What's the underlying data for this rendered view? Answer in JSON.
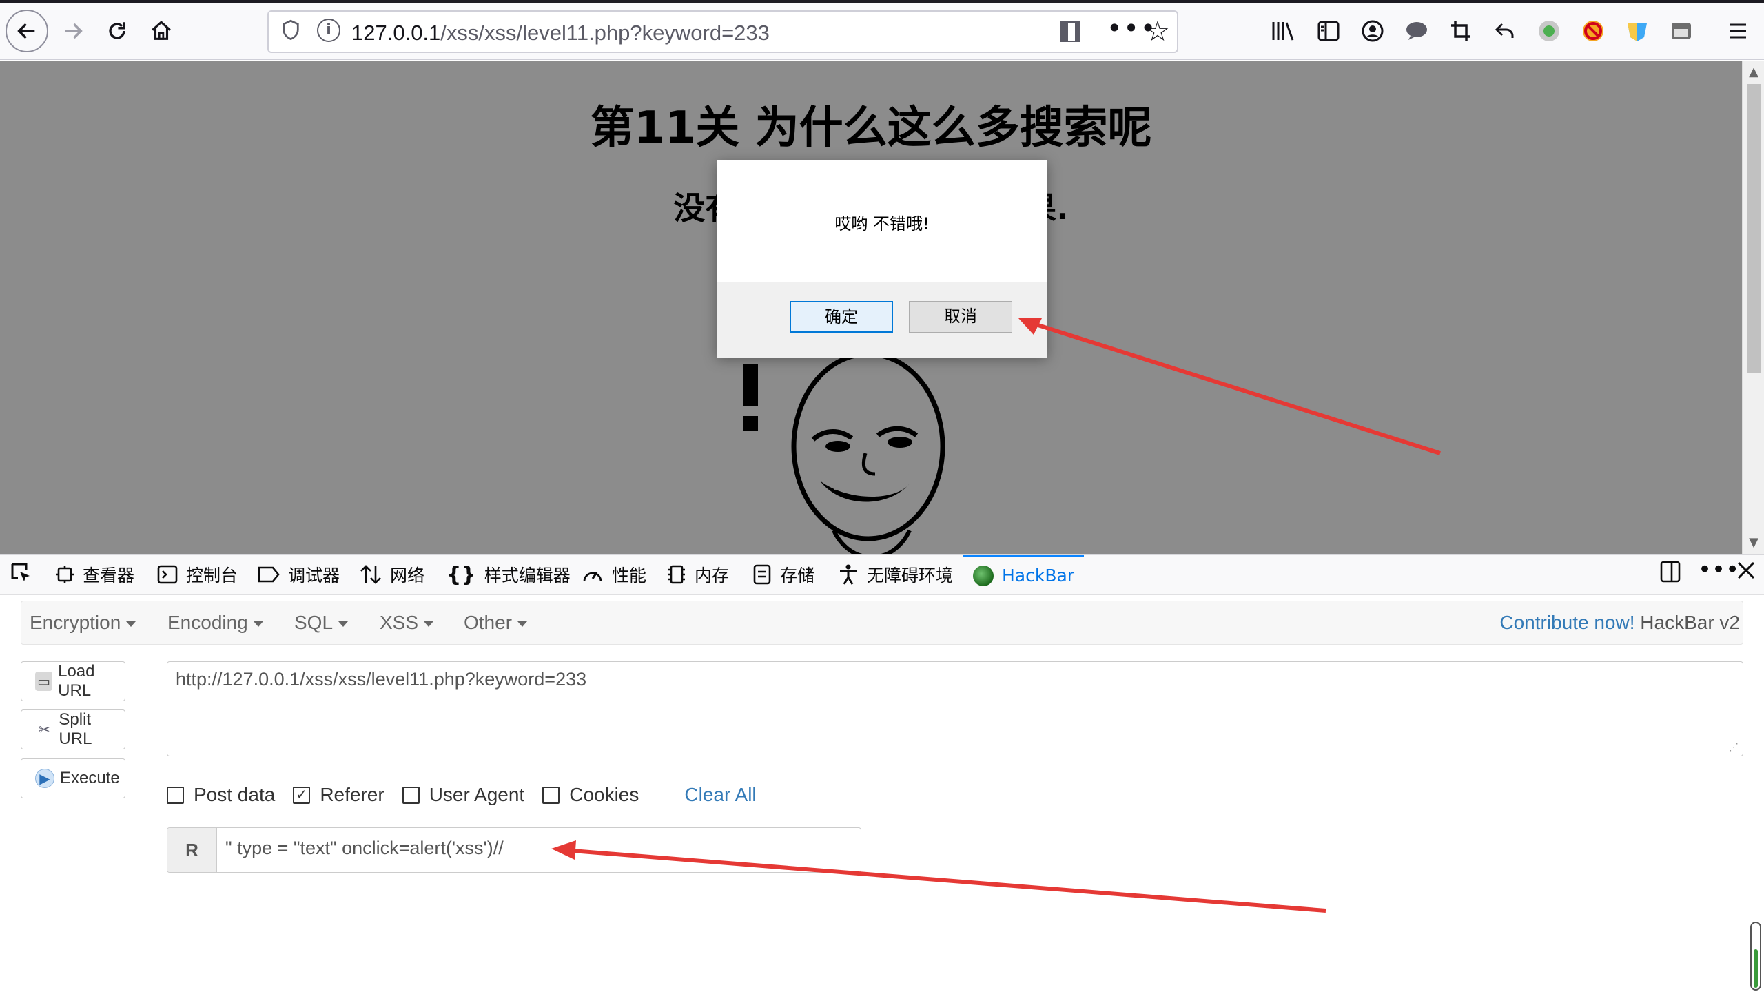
{
  "browser": {
    "url_host": "127.0.0.1",
    "url_path": "/xss/xss/level11.php?keyword=233"
  },
  "page": {
    "title": "第11关 为什么这么多搜索呢",
    "subtitle": "没有找到和233相关的结果."
  },
  "dialog": {
    "message": "哎哟 不错哦!",
    "ok_label": "确定",
    "cancel_label": "取消"
  },
  "devtools": {
    "tabs": [
      {
        "label": "查看器",
        "icon": "inspector-icon"
      },
      {
        "label": "控制台",
        "icon": "console-icon"
      },
      {
        "label": "调试器",
        "icon": "debugger-icon"
      },
      {
        "label": "网络",
        "icon": "network-icon"
      },
      {
        "label": "样式编辑器",
        "icon": "style-editor-icon"
      },
      {
        "label": "性能",
        "icon": "performance-icon"
      },
      {
        "label": "内存",
        "icon": "memory-icon"
      },
      {
        "label": "存储",
        "icon": "storage-icon"
      },
      {
        "label": "无障碍环境",
        "icon": "accessibility-icon"
      },
      {
        "label": "HackBar",
        "icon": "hackbar-icon"
      }
    ],
    "active_tab": "HackBar"
  },
  "hackbar": {
    "menu": [
      "Encryption",
      "Encoding",
      "SQL",
      "XSS",
      "Other"
    ],
    "contribute": "Contribute now!",
    "version": "HackBar v2",
    "buttons": {
      "load_url": "Load URL",
      "split_url": "Split URL",
      "execute": "Execute"
    },
    "url_value": "http://127.0.0.1/xss/xss/level11.php?keyword=233",
    "checks": {
      "post_data": {
        "label": "Post data",
        "checked": false
      },
      "referer": {
        "label": "Referer",
        "checked": true
      },
      "user_agent": {
        "label": "User Agent",
        "checked": false
      },
      "cookies": {
        "label": "Cookies",
        "checked": false
      }
    },
    "clear_all": "Clear All",
    "referer_label": "R",
    "referer_value": "\" type = \"text\" onclick=alert('xss')//"
  },
  "colors": {
    "accent_blue": "#0a84ff",
    "link_blue": "#337ab7",
    "annotation_red": "#e53935"
  }
}
